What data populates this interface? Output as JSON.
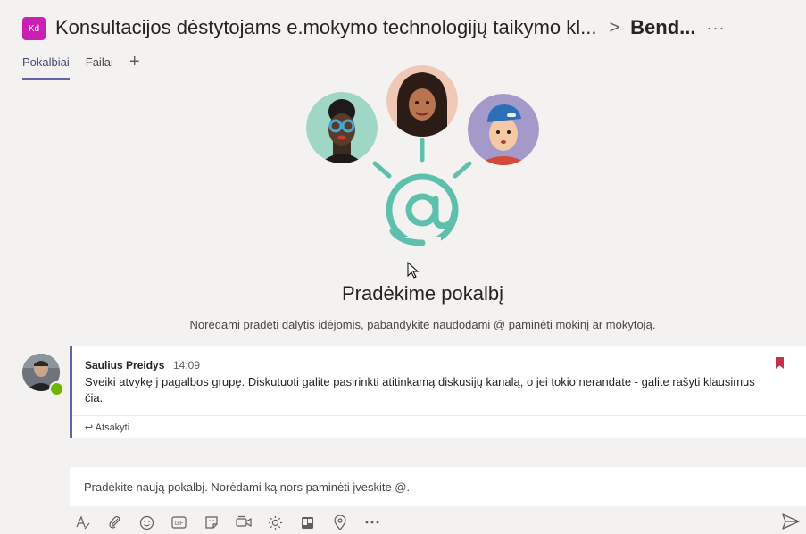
{
  "header": {
    "team_badge": "Kd",
    "team_name": "Konsultacijos dėstytojams e.mokymo technologijų taikymo kl...",
    "separator": ">",
    "channel_name": "Bend...",
    "more_label": "···",
    "tabs": [
      {
        "label": "Pokalbiai",
        "active": true
      },
      {
        "label": "Failai",
        "active": false
      }
    ],
    "add_tab_label": "+"
  },
  "empty_state": {
    "title": "Pradėkime pokalbį",
    "subtitle": "Norėdami pradėti dalytis idėjomis, pabandykite naudodami @ paminėti mokinį ar mokytoją.",
    "at_symbol": "@"
  },
  "post": {
    "author": "Saulius Preidys",
    "time": "14:09",
    "body": "Sveiki atvykę į pagalbos grupę. Diskutuoti galite pasirinkti atitinkamą diskusijų kanalą, o jei tokio nerandate - galite rašyti klausimus čia.",
    "reply_label": "Atsakyti"
  },
  "composer": {
    "placeholder": "Pradėkite naują pokalbį. Norėdami ką nors paminėti įveskite @.",
    "tools": [
      "format-icon",
      "attach-icon",
      "emoji-icon",
      "gif-icon",
      "sticker-icon",
      "meet-now-icon",
      "praise-icon",
      "planner-icon",
      "location-icon",
      "more-options-icon"
    ]
  },
  "colors": {
    "accent": "#6264a7",
    "team_badge": "#ca1fb5",
    "illustration_teal": "#5fbfad",
    "bookmark": "#c4314b",
    "presence": "#6bb700"
  }
}
